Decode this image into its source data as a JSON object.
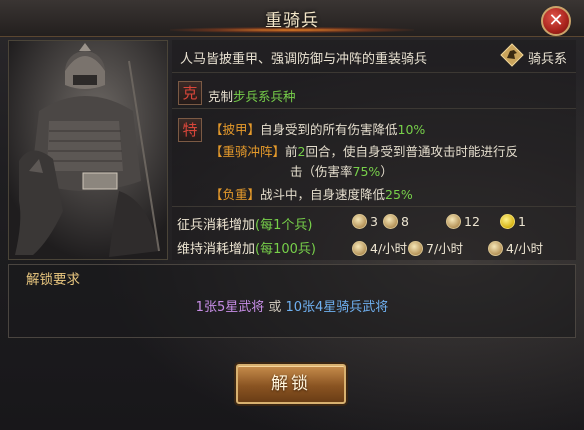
{
  "dialog": {
    "title": "重骑兵",
    "close_label": "✕"
  },
  "unit": {
    "description": "人马皆披重甲、强调防御与冲阵的重装骑兵",
    "type_label": "骑兵系",
    "counter_badge": "克",
    "counter_prefix": "克制",
    "counter_target": "步兵系兵种",
    "trait_badge": "特",
    "traits": [
      {
        "name": "【披甲】",
        "text": "自身受到的所有伤害降低",
        "value": "10%"
      },
      {
        "name": "【重骑冲阵】",
        "text_a": "前",
        "turns": "2",
        "text_b": "回合，使自身受到普通攻击时能进行反",
        "text_c": "击（伤害率",
        "rate": "75%",
        "text_d": "）"
      },
      {
        "name": "【负重】",
        "text": "战斗中，自身速度降低",
        "value": "25%"
      }
    ]
  },
  "costs": {
    "recruit_label": "征兵消耗增加",
    "recruit_unit": "(每1个兵)",
    "recruit_items": [
      {
        "icon": "wheat-icon",
        "value": "3"
      },
      {
        "icon": "wood-icon",
        "value": "8"
      },
      {
        "icon": "iron-icon",
        "value": "12"
      },
      {
        "icon": "coin-icon",
        "value": "1"
      }
    ],
    "upkeep_label": "维持消耗增加",
    "upkeep_unit": "(每100兵)",
    "upkeep_items": [
      {
        "icon": "wheat-icon",
        "value": "4/小时"
      },
      {
        "icon": "wood-icon",
        "value": "7/小时"
      },
      {
        "icon": "iron-icon",
        "value": "4/小时"
      }
    ]
  },
  "unlock": {
    "title": "解锁要求",
    "option_a": "1张5星武将",
    "or_text": " 或 ",
    "option_b": "10张4星骑兵武将",
    "button_label": "解锁"
  },
  "colors": {
    "accent_green": "#77d04a",
    "accent_orange": "#e59a2b",
    "option_purple": "#c78de6",
    "option_blue": "#6fb0f0",
    "title_gold": "#e9c77f"
  }
}
